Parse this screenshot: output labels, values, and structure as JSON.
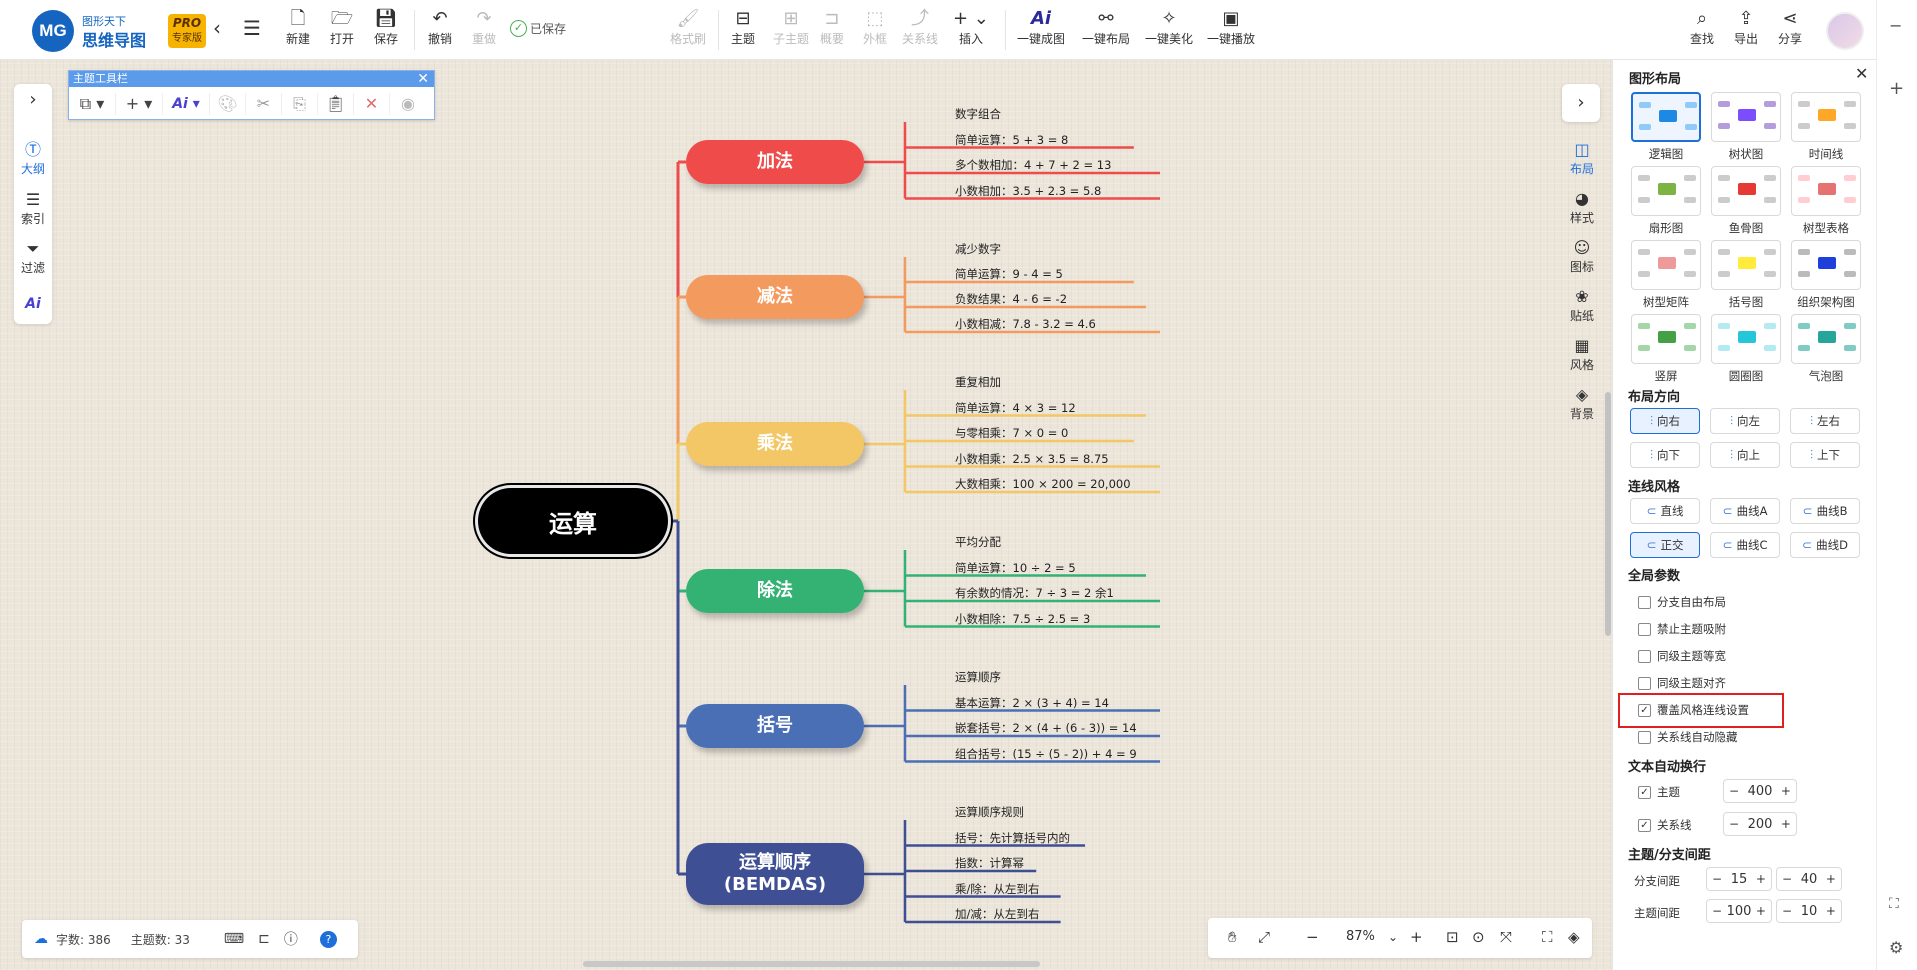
{
  "app": {
    "logo_mark": "MG",
    "logo_line1": "图形天下",
    "logo_line2": "思维导图",
    "pro_badge": "PRO",
    "pro_sub": "专家版",
    "saved_status": "已保存"
  },
  "toolbar": {
    "new": "新建",
    "open": "打开",
    "save": "保存",
    "undo": "撤销",
    "redo": "重做",
    "format_brush": "格式刷",
    "topic": "主题",
    "subtopic": "子主题",
    "summary": "概要",
    "boundary": "外框",
    "relation": "关系线",
    "insert": "插入",
    "ai_map": "一键成图",
    "auto_layout": "一键布局",
    "beautify": "一键美化",
    "play": "一键播放",
    "search": "查找",
    "export": "导出",
    "share": "分享"
  },
  "left_sidebar": {
    "outline": "大纲",
    "index": "索引",
    "filter": "过滤"
  },
  "topic_toolbar": {
    "title": "主题工具栏"
  },
  "mindmap": {
    "root": "运算",
    "branches": [
      {
        "label": "加法",
        "color": "#ef4b4b",
        "header": "数字组合",
        "items": [
          "简单运算：5 + 3 = 8",
          "多个数相加：4 + 7 + 2 = 13",
          "小数相加：3.5 + 2.3 = 5.8"
        ]
      },
      {
        "label": "减法",
        "color": "#f39a5e",
        "header": "减少数字",
        "items": [
          "简单运算：9 - 4 = 5",
          "负数结果：4 - 6 = -2",
          "小数相减：7.8 - 3.2 = 4.6"
        ]
      },
      {
        "label": "乘法",
        "color": "#f3c766",
        "header": "重复相加",
        "items": [
          "简单运算：4 × 3 = 12",
          "与零相乘：7 × 0 = 0",
          "小数相乘：2.5 × 3.5 = 8.75",
          "大数相乘：100 × 200 = 20,000"
        ]
      },
      {
        "label": "除法",
        "color": "#34b274",
        "header": "平均分配",
        "items": [
          "简单运算：10 ÷ 2 = 5",
          "有余数的情况：7 ÷ 3 = 2 余1",
          "小数相除：7.5 ÷ 2.5 = 3"
        ]
      },
      {
        "label": "括号",
        "color": "#4a6fb5",
        "header": "运算顺序",
        "items": [
          "基本运算：2 × (3 + 4) = 14",
          "嵌套括号：2 × (4 + (6 - 3)) = 14",
          "组合括号：(15 ÷ (5 - 2)) + 4 = 9"
        ]
      },
      {
        "label": "运算顺序",
        "label2": "(BEMDAS)",
        "color": "#3f4f94",
        "header": "运算顺序规则",
        "items": [
          "括号：先计算括号内的",
          "指数：计算幂",
          "乘/除：从左到右",
          "加/减：从左到右"
        ]
      }
    ]
  },
  "right_icons": {
    "layout": "布局",
    "style": "样式",
    "icon": "图标",
    "sticker": "贴纸",
    "theme": "风格",
    "background": "背景"
  },
  "panel": {
    "title": "图形布局",
    "layouts": [
      "逻辑图",
      "树状图",
      "时间线",
      "扇形图",
      "鱼骨图",
      "树型表格",
      "树型矩阵",
      "括号图",
      "组织架构图",
      "竖屏",
      "圆圈图",
      "气泡图"
    ],
    "direction_title": "布局方向",
    "directions": [
      "向右",
      "向左",
      "左右",
      "向下",
      "向上",
      "上下"
    ],
    "line_style_title": "连线风格",
    "line_styles": [
      "直线",
      "曲线A",
      "曲线B",
      "正交",
      "曲线C",
      "曲线D"
    ],
    "global_title": "全局参数",
    "global_options": [
      {
        "label": "分支自由布局",
        "checked": false
      },
      {
        "label": "禁止主题吸附",
        "checked": false
      },
      {
        "label": "同级主题等宽",
        "checked": false
      },
      {
        "label": "同级主题对齐",
        "checked": false
      },
      {
        "label": "覆盖风格连线设置",
        "checked": true
      },
      {
        "label": "关系线自动隐藏",
        "checked": false
      }
    ],
    "wrap_title": "文本自动换行",
    "wrap_topic_label": "主题",
    "wrap_topic_value": "400",
    "wrap_relation_label": "关系线",
    "wrap_relation_value": "200",
    "spacing_title": "主题/分支间距",
    "branch_spacing_label": "分支间距",
    "branch_spacing_a": "15",
    "branch_spacing_b": "40",
    "topic_spacing_label": "主题间距",
    "topic_spacing_a": "100",
    "topic_spacing_b": "10"
  },
  "status": {
    "word_count": "字数: 386",
    "topic_count": "主题数: 33"
  },
  "zoom": {
    "level": "87%"
  }
}
